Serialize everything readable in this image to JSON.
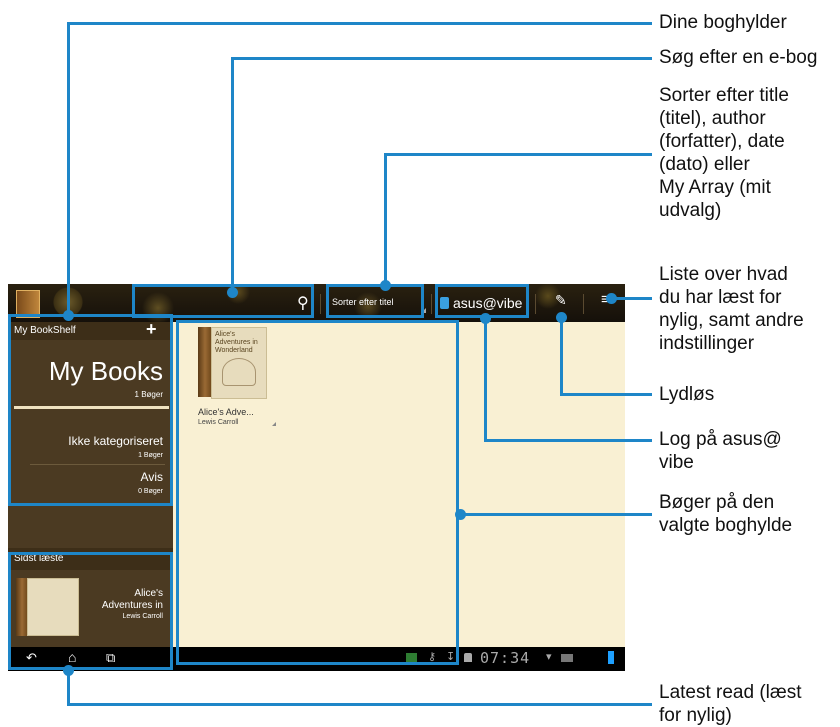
{
  "app": {
    "sort_label": "Sorter efter titel",
    "brand_label": "asus@vibe"
  },
  "sidebar": {
    "shelf_header": "My BookShelf",
    "selected_title": "My Books",
    "selected_count": "1 Bøger",
    "categories": [
      {
        "name": "Ikke kategoriseret",
        "count": "1 Bøger"
      },
      {
        "name": "Avis",
        "count": "0 Bøger"
      }
    ],
    "recent_header": "Sidst læste",
    "recent_title_line1": "Alice's",
    "recent_title_line2": "Adventures in",
    "recent_author": "Lewis Carroll"
  },
  "main": {
    "book_cover_text": "Alice's Adventures in Wonderland",
    "book_title": "Alice's Adve...",
    "book_author": "Lewis Carroll"
  },
  "status": {
    "time": "07:34"
  },
  "annotations": {
    "bookshelves": "Dine boghylder",
    "search": "Søg efter en e-bog",
    "sort": [
      "Sorter efter title",
      "(titel), author",
      "(forfatter), date",
      "(dato) eller",
      "My Array (mit",
      "udvalg)"
    ],
    "recent_menu": [
      "Liste over hvad",
      "du har læst for",
      "nylig, samt andre",
      "indstillinger"
    ],
    "mute": "Lydløs",
    "login": [
      "Log på asus@",
      "vibe"
    ],
    "books": [
      "Bøger på den",
      "valgte boghylde"
    ],
    "latest": [
      "Latest read (læst",
      "for nylig)"
    ]
  },
  "colors": {
    "callout": "#1e86c8",
    "main_bg": "#f9f0d3",
    "sidebar_bg": "#4b3a22"
  }
}
